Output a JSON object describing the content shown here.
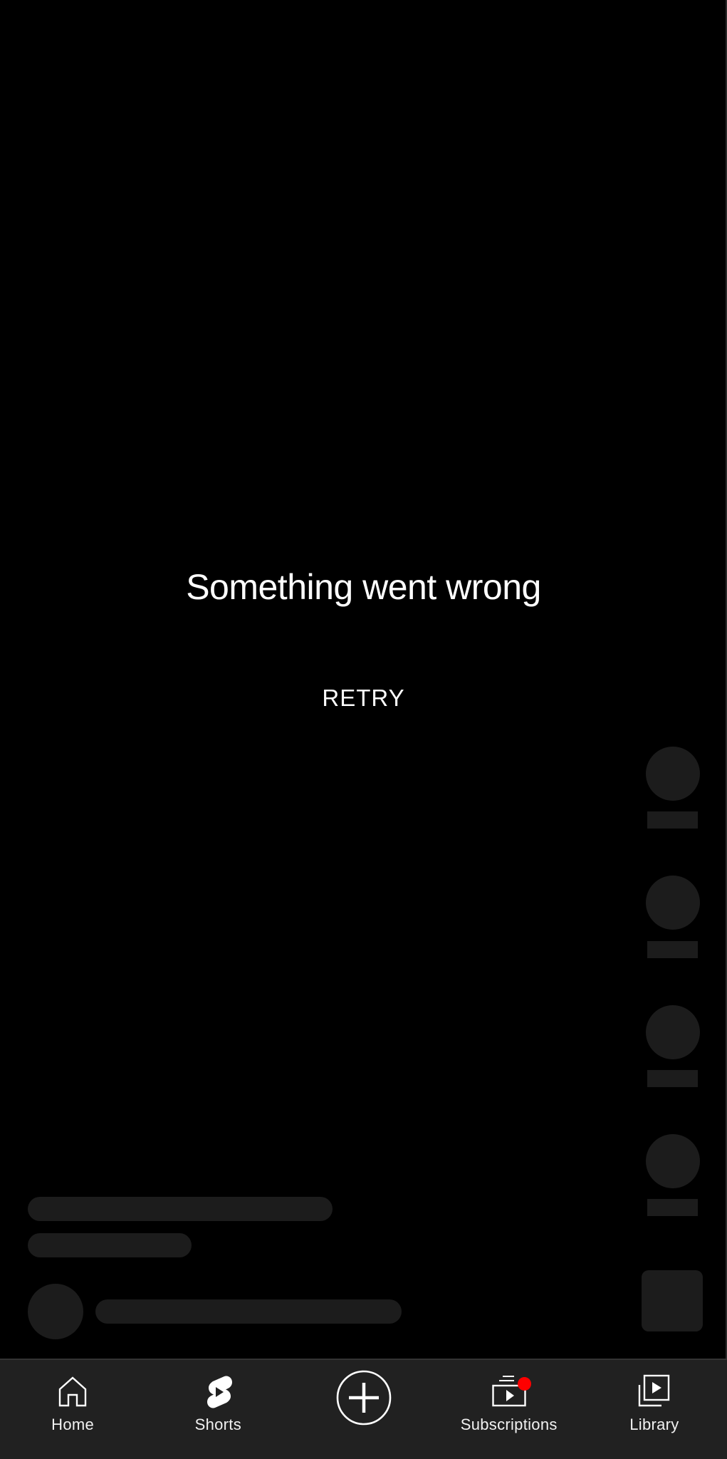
{
  "error": {
    "title": "Something went wrong",
    "retry_label": "RETRY"
  },
  "skeleton": {
    "action_rail_count": 4,
    "description_lines": 2
  },
  "bottom_nav": {
    "items": [
      {
        "id": "home",
        "label": "Home",
        "icon": "home-icon",
        "active": false
      },
      {
        "id": "shorts",
        "label": "Shorts",
        "icon": "shorts-icon",
        "active": true
      },
      {
        "id": "create",
        "label": "",
        "icon": "create-plus-icon",
        "active": false
      },
      {
        "id": "subscriptions",
        "label": "Subscriptions",
        "icon": "subscriptions-icon",
        "active": false,
        "has_badge": true
      },
      {
        "id": "library",
        "label": "Library",
        "icon": "library-icon",
        "active": false
      }
    ],
    "badge_color": "#ff0000"
  },
  "colors": {
    "background": "#000000",
    "nav_background": "#212121",
    "skeleton": "#1c1c1c",
    "text": "#ffffff"
  }
}
